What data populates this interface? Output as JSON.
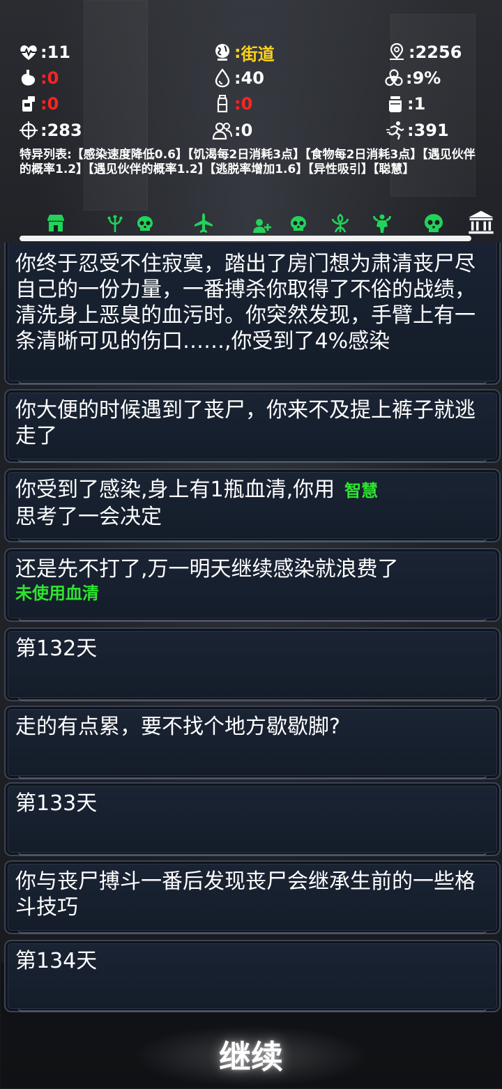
{
  "stats": {
    "health": "11",
    "location": "街道",
    "distance": "2256",
    "hunger": "0",
    "water": "40",
    "infection": "9%",
    "food": "0",
    "drink": "0",
    "serum": "1",
    "attack": "283",
    "companions": "0",
    "escape": "391",
    "colon": ":"
  },
  "traits_text": "特异列表:【感染速度降低0.6】【饥渴每2日消耗3点】【食物每2日消耗3点】【遇见伙伴的概率1.2】【遇见伙伴的概率1.2】【逃脱率增加1.6】【异性吸引】【聪慧】",
  "icons": [
    "shop-icon",
    "trident-icon",
    "skull-icon",
    "plane-icon",
    "add-person-icon",
    "skull-icon",
    "bloom-icon",
    "muscle-icon",
    "skull-icon",
    "bank-icon"
  ],
  "log": [
    {
      "text": "你终于忍受不住寂寞，踏出了房门想为肃清丧尸尽自己的一份力量，一番搏杀你取得了不俗的战绩，清洗身上恶臭的血污时。你突然发现，手臂上有一条清晰可见的伤口……,你受到了4%感染"
    },
    {
      "text": "你大便的时候遇到了丧尸，你来不及提上裤子就逃走了"
    },
    {
      "text_a": "你受到了感染,身上有1瓶血清,你用",
      "green": "智慧",
      "text_b": "思考了一会决定"
    },
    {
      "text": "还是先不打了,万一明天继续感染就浪费了",
      "green_note": "未使用血清"
    },
    {
      "text": "第132天"
    },
    {
      "text": "走的有点累，要不找个地方歇歇脚?"
    },
    {
      "text": "第133天"
    },
    {
      "text": "你与丧尸搏斗一番后发现丧尸会继承生前的一些格斗技巧"
    },
    {
      "text": "第134天"
    }
  ],
  "continue_label": "继续",
  "colors": {
    "green": "#2ee52e",
    "red": "#ff2424",
    "yellow": "#ffd21a"
  }
}
